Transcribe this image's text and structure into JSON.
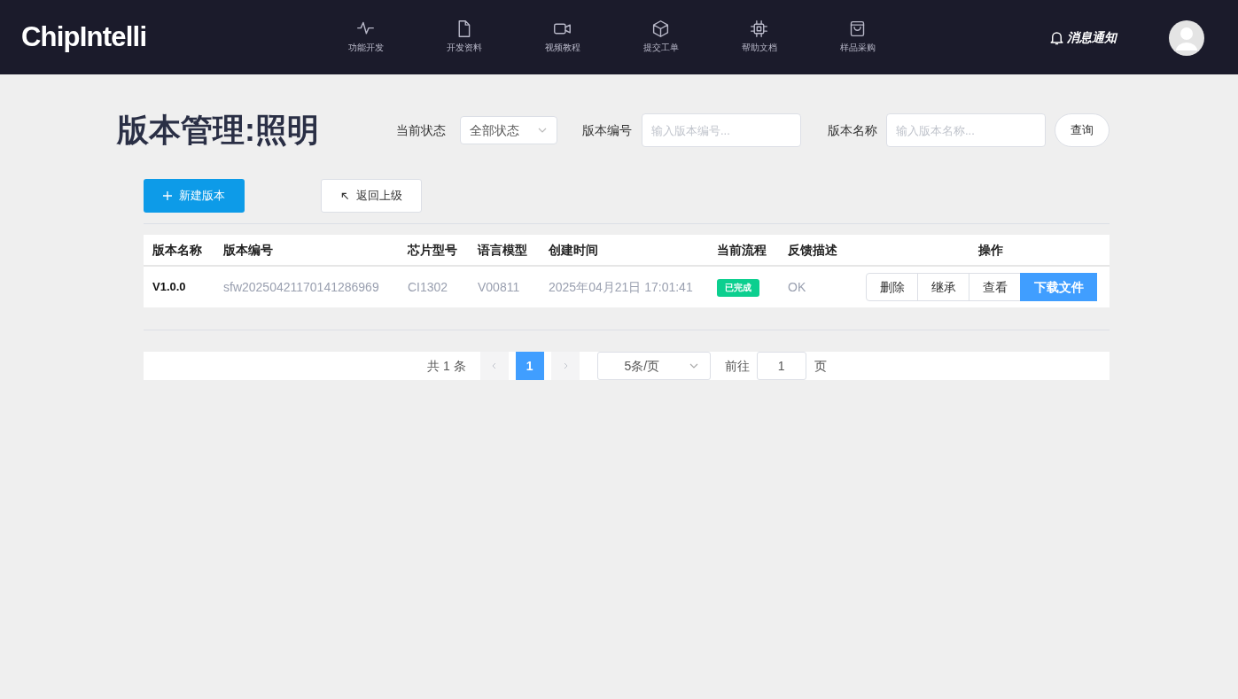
{
  "header": {
    "logo": "ChipIntelli",
    "nav": [
      {
        "label": "功能开发"
      },
      {
        "label": "开发资料"
      },
      {
        "label": "视频教程"
      },
      {
        "label": "提交工单"
      },
      {
        "label": "帮助文档"
      },
      {
        "label": "样品采购"
      }
    ],
    "notification": "消息通知"
  },
  "page_title": "版本管理:照明",
  "filters": {
    "status_label": "当前状态",
    "status_value": "全部状态",
    "number_label": "版本编号",
    "number_placeholder": "输入版本编号...",
    "name_label": "版本名称",
    "name_placeholder": "输入版本名称...",
    "query_button": "查询"
  },
  "actions": {
    "new_button": "新建版本",
    "back_button": "返回上级"
  },
  "table": {
    "columns": [
      "版本名称",
      "版本编号",
      "芯片型号",
      "语言模型",
      "创建时间",
      "当前流程",
      "反馈描述",
      "操作"
    ],
    "rows": [
      {
        "name": "V1.0.0",
        "number": "sfw20250421170141286969",
        "chip": "CI1302",
        "model": "V00811",
        "created": "2025年04月21日 17:01:41",
        "status": {
          "label": "已完成",
          "color": "#0ccf8f"
        },
        "feedback": "OK",
        "buttons": [
          {
            "label": "删除",
            "kind": "default"
          },
          {
            "label": "继承",
            "kind": "default"
          },
          {
            "label": "查看",
            "kind": "default"
          },
          {
            "label": "下载文件",
            "kind": "primary"
          }
        ]
      }
    ]
  },
  "pagination": {
    "total": "共 1 条",
    "prev_disabled": true,
    "next_disabled": true,
    "pages": [
      {
        "label": "1",
        "selected": true
      }
    ],
    "page_size": "5条/页",
    "goto_label": "前往",
    "goto_value": "1",
    "goto_suffix": "页"
  }
}
